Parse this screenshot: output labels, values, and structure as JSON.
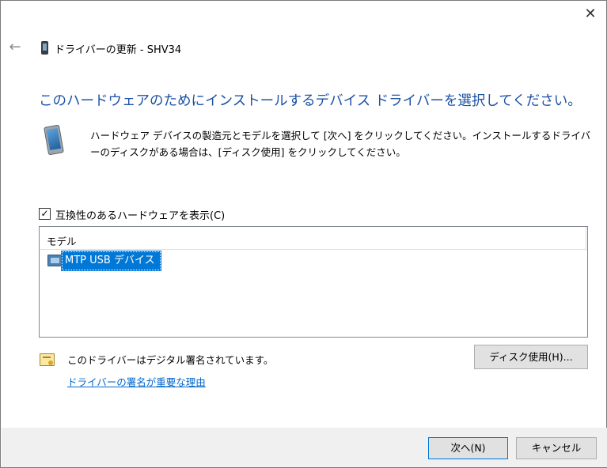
{
  "window": {
    "title": "ドライバーの更新 - SHV34",
    "close_glyph": "✕",
    "back_glyph": "←"
  },
  "heading": "このハードウェアのためにインストールするデバイス ドライバーを選択してください。",
  "instruction": "ハードウェア デバイスの製造元とモデルを選択して [次へ] をクリックしてください。インストールするドライバーのディスクがある場合は、[ディスク使用] をクリックしてください。",
  "compat_checkbox": {
    "label": "互換性のあるハードウェアを表示(C)",
    "checked": true,
    "check_glyph": "✓"
  },
  "model_list": {
    "header": "モデル",
    "items": [
      {
        "label": "MTP USB デバイス",
        "selected": true
      }
    ]
  },
  "signature": {
    "status": "このドライバーはデジタル署名されています。",
    "link": "ドライバーの署名が重要な理由"
  },
  "buttons": {
    "have_disk": "ディスク使用(H)...",
    "next": "次へ(N)",
    "cancel": "キャンセル"
  },
  "colors": {
    "heading": "#1c51a4",
    "selection": "#0078d7",
    "link": "#0066cc",
    "footer": "#f0f0f0"
  },
  "icons": [
    "close-icon",
    "back-arrow-icon",
    "device-icon",
    "phone-device-icon",
    "checkbox-check-icon",
    "device-list-icon",
    "certificate-icon"
  ]
}
